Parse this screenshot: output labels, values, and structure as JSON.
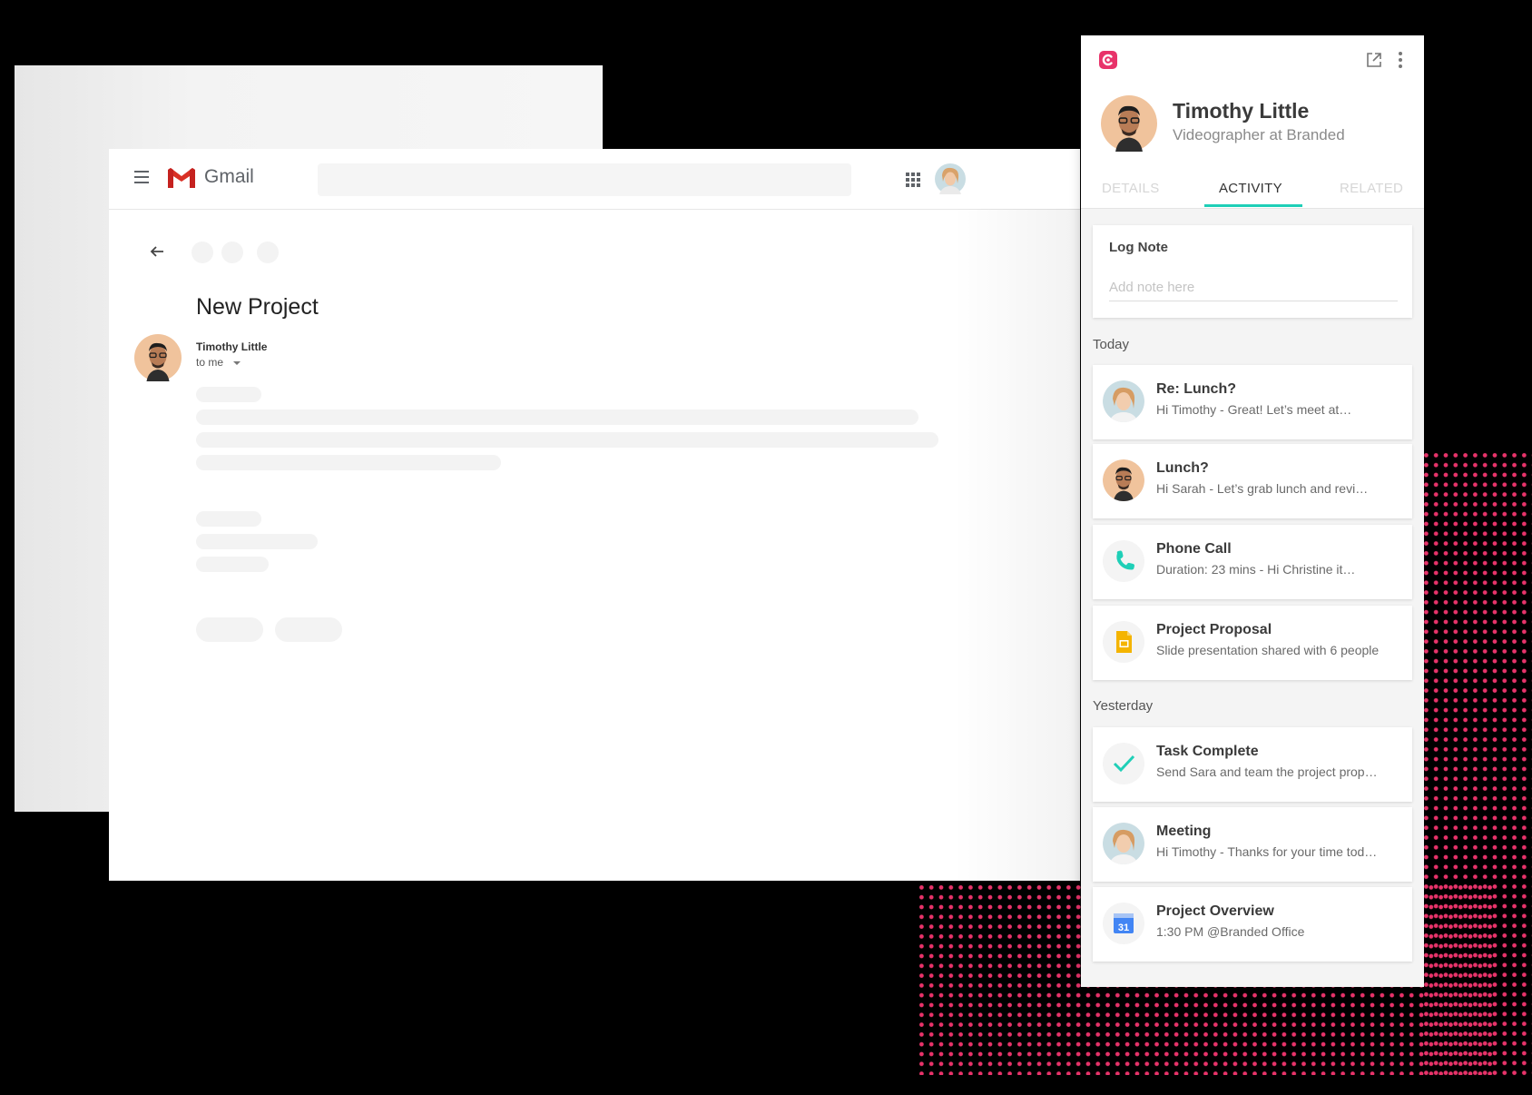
{
  "gmail": {
    "app_name": "Gmail",
    "email": {
      "subject": "New Project",
      "sender_name": "Timothy Little",
      "recipient": "to me"
    }
  },
  "panel": {
    "profile": {
      "name": "Timothy Little",
      "title": "Videographer at Branded"
    },
    "tabs": [
      {
        "label": "DETAILS",
        "active": false
      },
      {
        "label": "ACTIVITY",
        "active": true
      },
      {
        "label": "RELATED",
        "active": false
      }
    ],
    "log_note": {
      "label": "Log Note",
      "placeholder": "Add note here"
    },
    "sections": {
      "today": "Today",
      "yesterday": "Yesterday"
    },
    "activities": [
      {
        "icon": "woman-avatar",
        "title": "Re: Lunch?",
        "subtitle": "Hi Timothy -  Great! Let’s meet at…"
      },
      {
        "icon": "man-avatar",
        "title": "Lunch?",
        "subtitle": "Hi Sarah - Let’s grab lunch and revi…"
      },
      {
        "icon": "phone-icon",
        "title": "Phone Call",
        "subtitle": "Duration: 23 mins -  Hi Christine it…"
      },
      {
        "icon": "slides-icon",
        "title": "Project Proposal",
        "subtitle": "Slide presentation shared with 6 people"
      },
      {
        "icon": "check-icon",
        "title": "Task Complete",
        "subtitle": "Send Sara and team the project prop…"
      },
      {
        "icon": "woman-avatar",
        "title": "Meeting",
        "subtitle": "Hi Timothy - Thanks for your time tod…"
      },
      {
        "icon": "calendar-icon",
        "title": "Project Overview",
        "subtitle": "1:30 PM @Branded Office",
        "calendar_day": "31"
      }
    ]
  },
  "colors": {
    "accent_teal": "#1fcfb7",
    "brand_pink": "#e8336a",
    "gmail_red": "#d93025",
    "slides_yellow": "#f4b400",
    "calendar_blue": "#4285f4"
  }
}
